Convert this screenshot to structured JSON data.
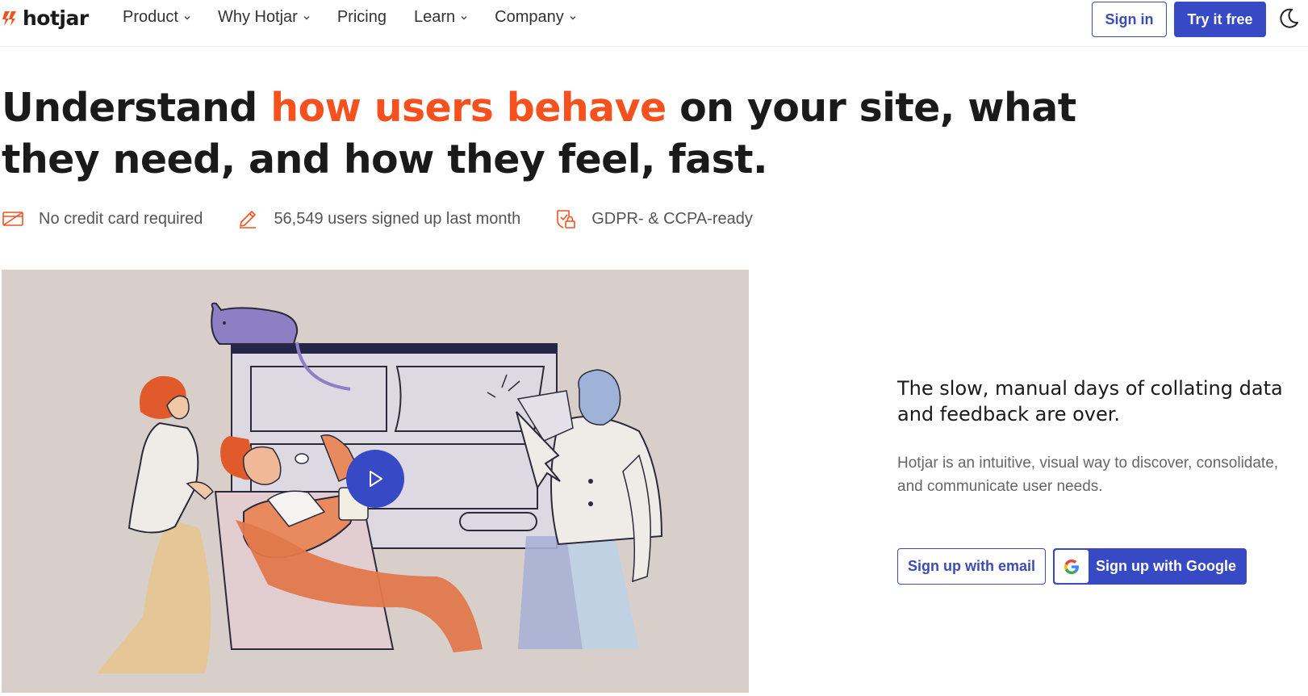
{
  "header": {
    "logo_text": "hotjar",
    "nav": [
      {
        "label": "Product",
        "has_dropdown": true
      },
      {
        "label": "Why Hotjar",
        "has_dropdown": true
      },
      {
        "label": "Pricing",
        "has_dropdown": false
      },
      {
        "label": "Learn",
        "has_dropdown": true
      },
      {
        "label": "Company",
        "has_dropdown": true
      }
    ],
    "signin_label": "Sign in",
    "try_label": "Try it free",
    "theme_icon": "moon-icon"
  },
  "hero": {
    "headline_before": "Understand ",
    "headline_accent": "how users behave",
    "headline_after": " on your site, what they need, and how they feel, fast.",
    "badges": [
      {
        "icon": "credit-card-off-icon",
        "label": "No credit card required"
      },
      {
        "icon": "pencil-icon",
        "label": "56,549 users signed up last month"
      },
      {
        "icon": "shield-lock-icon",
        "label": "GDPR- & CCPA-ready"
      }
    ]
  },
  "video": {
    "play_icon": "play-icon"
  },
  "side": {
    "title": "The slow, manual days of collating data and feedback are over.",
    "description": "Hotjar is an intuitive, visual way to discover, consolidate, and communicate user needs.",
    "email_button": "Sign up with email",
    "google_button": "Sign up with Google"
  },
  "colors": {
    "accent_orange": "#f4511e",
    "brand_blue": "#3749c4",
    "illustration_bg": "#d8cfcb"
  }
}
